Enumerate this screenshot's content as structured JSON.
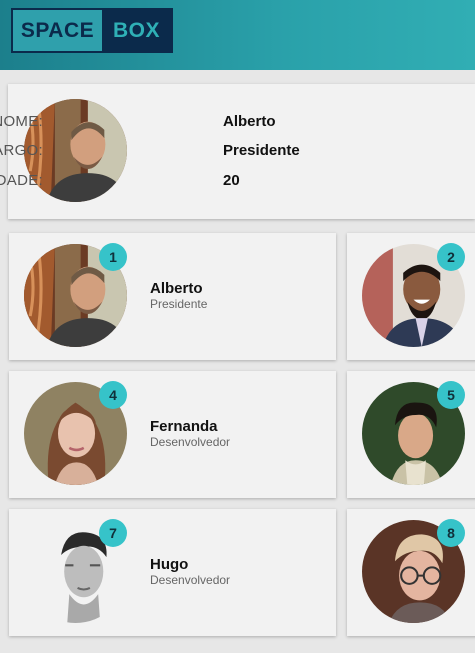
{
  "brand": {
    "part1": "SPACE",
    "part2": "BOX"
  },
  "selected": {
    "name_label": "NOME:",
    "name": "Alberto",
    "role_label": "CARGO:",
    "role": "Presidente",
    "age_label": "IDADE:",
    "age": "20"
  },
  "members": [
    {
      "number": "1",
      "name": "Alberto",
      "role": "Presidente"
    },
    {
      "number": "2",
      "name": "",
      "role": ""
    },
    {
      "number": "4",
      "name": "Fernanda",
      "role": "Desenvolvedor"
    },
    {
      "number": "5",
      "name": "",
      "role": ""
    },
    {
      "number": "7",
      "name": "Hugo",
      "role": "Desenvolvedor"
    },
    {
      "number": "8",
      "name": "",
      "role": ""
    }
  ],
  "colors": {
    "accent": "#36c3c9",
    "brand_dark": "#0b2a4b",
    "header": "#2aa1aa"
  }
}
